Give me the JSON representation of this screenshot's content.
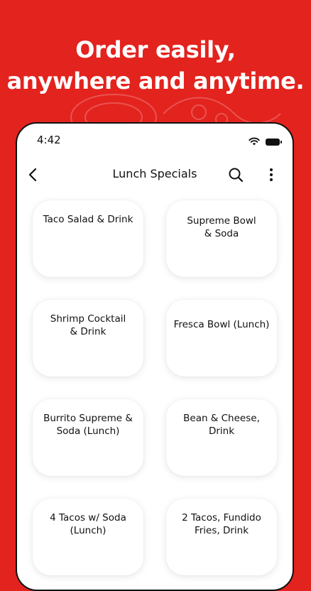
{
  "promo": {
    "line1": "Order easily,",
    "line2": "anywhere and anytime."
  },
  "status_bar": {
    "time": "4:42"
  },
  "app_bar": {
    "title": "Lunch Specials"
  },
  "menu_items": [
    {
      "label": "Taco Salad & Drink"
    },
    {
      "label": "Supreme Bowl & Soda"
    },
    {
      "label": "Shrimp Cocktail & Drink"
    },
    {
      "label": "Fresca Bowl (Lunch)"
    },
    {
      "label": "Burrito Supreme & Soda (Lunch)"
    },
    {
      "label": "Bean & Cheese, Drink"
    },
    {
      "label": "4 Tacos w/ Soda (Lunch)"
    },
    {
      "label": "2 Tacos, Fundido Fries, Drink"
    }
  ],
  "colors": {
    "brand_red": "#e3231e",
    "card_bg": "#ffffff",
    "text": "#111111"
  },
  "icons": {
    "back": "chevron-left-icon",
    "search": "search-icon",
    "more": "more-vertical-icon",
    "wifi": "wifi-icon",
    "battery": "battery-icon"
  }
}
